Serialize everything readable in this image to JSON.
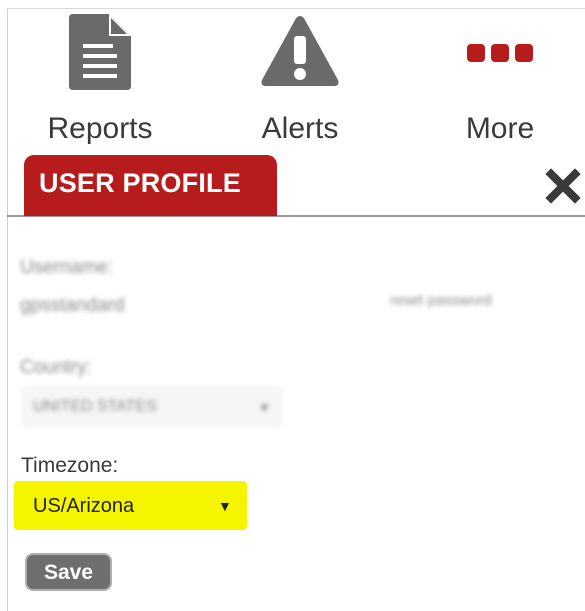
{
  "nav": {
    "items": [
      {
        "label": "Reports",
        "icon": "document-icon"
      },
      {
        "label": "Alerts",
        "icon": "warning-icon"
      },
      {
        "label": "More",
        "icon": "more-dots-icon"
      }
    ]
  },
  "panel": {
    "tab_label": "USER PROFILE",
    "accent_color": "#b71c1c"
  },
  "form": {
    "username_label": "Username:",
    "username_value": "gpsstandard",
    "reset_password_link": "reset password",
    "country_label": "Country:",
    "country_value": "UNITED STATES",
    "timezone_label": "Timezone:",
    "timezone_value": "US/Arizona",
    "highlight_color": "#f5f500",
    "save_label": "Save"
  }
}
